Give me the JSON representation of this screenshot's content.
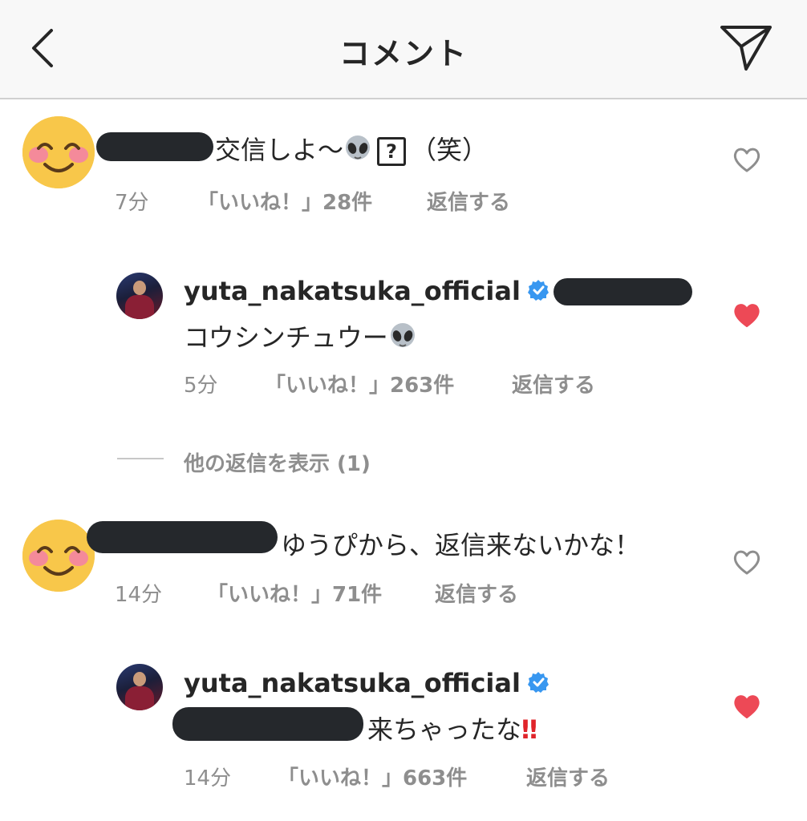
{
  "header": {
    "title": "コメント",
    "back_icon": "chevron-left-icon",
    "share_icon": "paper-plane-icon"
  },
  "comments": [
    {
      "text": "交信しよ〜",
      "suffix": "（笑）",
      "time": "7分",
      "likes": "「いいね！」28件",
      "reply": "返信する",
      "liked": false
    },
    {
      "username": "yuta_nakatsuka_official",
      "text": "コウシンチュウー",
      "time": "5分",
      "likes": "「いいね！」263件",
      "reply": "返信する",
      "liked": true
    },
    {
      "text": "ゆうぴから、返信来ないかな！",
      "time": "14分",
      "likes": "「いいね！」71件",
      "reply": "返信する",
      "liked": false
    },
    {
      "username": "yuta_nakatsuka_official",
      "text": "来ちゃったな",
      "emphasis": "‼",
      "time": "14分",
      "likes": "「いいね！」663件",
      "reply": "返信する",
      "liked": true
    }
  ],
  "view_more": "他の返信を表示 (1)",
  "colors": {
    "heart_liked": "#ed4956",
    "verified": "#3897f0",
    "meta": "#8e8e8e"
  }
}
